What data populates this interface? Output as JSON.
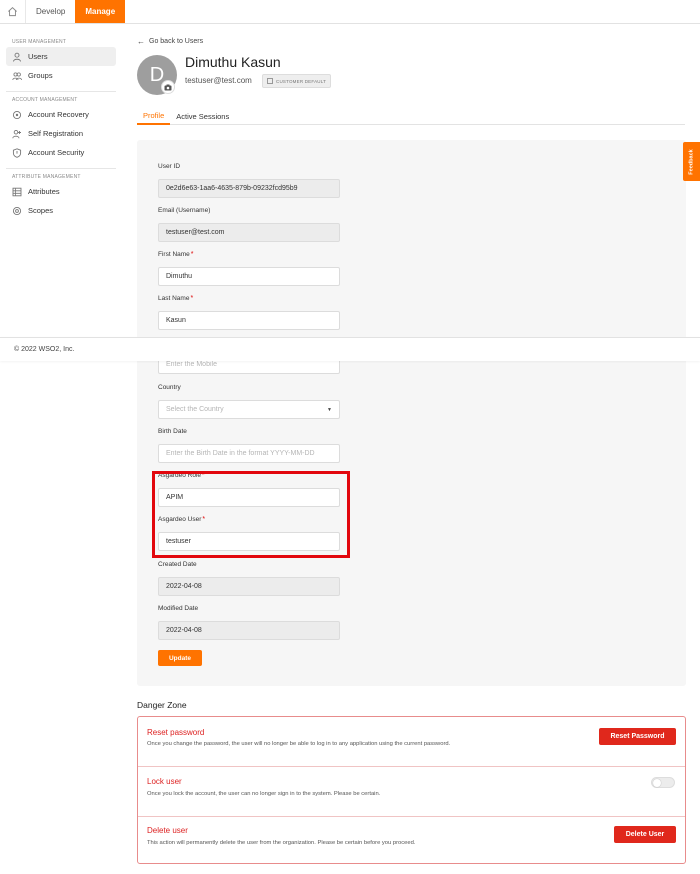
{
  "topbar": {
    "tabs": [
      {
        "label": "Develop",
        "active": false
      },
      {
        "label": "Manage",
        "active": true
      }
    ]
  },
  "sidebar": {
    "sections": [
      {
        "title": "USER MANAGEMENT",
        "items": [
          {
            "label": "Users",
            "icon": "user-icon",
            "active": true
          },
          {
            "label": "Groups",
            "icon": "group-icon",
            "active": false
          }
        ]
      },
      {
        "title": "ACCOUNT MANAGEMENT",
        "items": [
          {
            "label": "Account Recovery",
            "icon": "recovery-icon",
            "active": false
          },
          {
            "label": "Self Registration",
            "icon": "self-registration-icon",
            "active": false
          },
          {
            "label": "Account Security",
            "icon": "shield-icon",
            "active": false
          }
        ]
      },
      {
        "title": "ATTRIBUTE MANAGEMENT",
        "items": [
          {
            "label": "Attributes",
            "icon": "list-icon",
            "active": false
          },
          {
            "label": "Scopes",
            "icon": "scope-icon",
            "active": false
          }
        ]
      }
    ]
  },
  "back_link": "Go back to Users",
  "user": {
    "initial": "D",
    "name": "Dimuthu Kasun",
    "email": "testuser@test.com",
    "badge": "CUSTOMER DEFAULT"
  },
  "tabs": [
    {
      "label": "Profile",
      "active": true
    },
    {
      "label": "Active Sessions",
      "active": false
    }
  ],
  "fields": {
    "user_id": {
      "label": "User ID",
      "value": "0e2d6e63-1aa6-4635-879b-09232fcd95b9"
    },
    "email": {
      "label": "Email (Username)",
      "value": "testuser@test.com"
    },
    "first_name": {
      "label": "First Name",
      "value": "Dimuthu",
      "required": "*"
    },
    "last_name": {
      "label": "Last Name",
      "value": "Kasun",
      "required": "*"
    },
    "mobile": {
      "placeholder": "Enter the Mobile"
    },
    "country": {
      "label": "Country",
      "placeholder": "Select the Country"
    },
    "birth_date": {
      "label": "Birth Date",
      "placeholder": "Enter the Birth Date in the format YYYY-MM-DD"
    },
    "asgardeo_role": {
      "label": "Asgardeo Role",
      "value": "APIM",
      "required": "*"
    },
    "asgardeo_user": {
      "label": "Asgardeo User",
      "value": "testuser",
      "required": "*"
    },
    "created_date": {
      "label": "Created Date",
      "value": "2022-04-08"
    },
    "modified_date": {
      "label": "Modified Date",
      "value": "2022-04-08"
    }
  },
  "update_button": "Update",
  "danger_zone": {
    "title": "Danger Zone",
    "reset": {
      "title": "Reset password",
      "description": "Once you change the password, the user will no longer be able to log in to any application using the current password.",
      "button": "Reset Password"
    },
    "lock": {
      "title": "Lock user",
      "description": "Once you lock the account, the user can no longer sign in to the system. Please be certain."
    },
    "delete": {
      "title": "Delete user",
      "description": "This action will permanently delete the user from the organization. Please be certain before you proceed.",
      "button": "Delete User"
    }
  },
  "footer": "© 2022 WSO2, Inc.",
  "feedback": "Feedback",
  "colors": {
    "accent": "#ff7300",
    "danger": "#e0281c",
    "highlight": "#e2070d"
  }
}
